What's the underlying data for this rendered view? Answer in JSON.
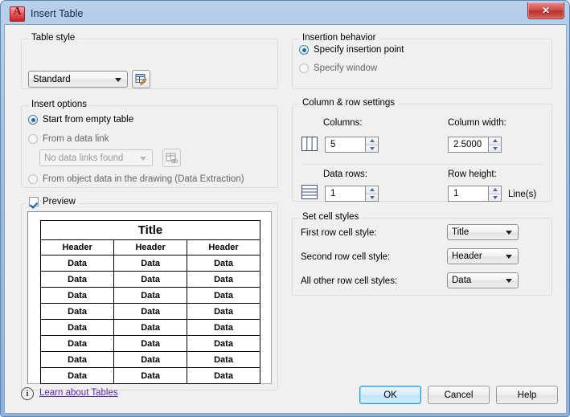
{
  "window": {
    "title": "Insert Table",
    "logo_letter": "A",
    "close_label": "✕"
  },
  "table_style": {
    "group_title": "Table style",
    "selected": "Standard",
    "edit_button_icon": "table-style-edit-icon"
  },
  "insert_options": {
    "group_title": "Insert options",
    "options": [
      {
        "label": "Start from empty table",
        "selected": true,
        "disabled": false
      },
      {
        "label": "From a data link",
        "selected": false,
        "disabled": false
      },
      {
        "label": "From object data in the drawing (Data Extraction)",
        "selected": false,
        "disabled": false
      }
    ],
    "data_link_combo": {
      "value": "No data links found",
      "disabled": true
    },
    "data_link_button_icon": "data-link-icon"
  },
  "insertion_behavior": {
    "group_title": "Insertion behavior",
    "options": [
      {
        "label": "Specify insertion point",
        "selected": true
      },
      {
        "label": "Specify window",
        "selected": false
      }
    ]
  },
  "column_row_settings": {
    "group_title": "Column & row settings",
    "columns_label": "Columns:",
    "columns_value": "5",
    "column_width_label": "Column width:",
    "column_width_value": "2.5000",
    "data_rows_label": "Data rows:",
    "data_rows_value": "1",
    "row_height_label": "Row height:",
    "row_height_value": "1",
    "row_height_units": "Line(s)",
    "columns_icon": "columns-icon",
    "rows_icon": "rows-icon"
  },
  "cell_styles": {
    "group_title": "Set cell styles",
    "rows": [
      {
        "label": "First row cell style:",
        "value": "Title"
      },
      {
        "label": "Second row cell style:",
        "value": "Header"
      },
      {
        "label": "All other row cell styles:",
        "value": "Data"
      }
    ]
  },
  "preview": {
    "checkbox_label": "Preview",
    "checked": true,
    "table": {
      "title": "Title",
      "headers": [
        "Header",
        "Header",
        "Header"
      ],
      "data_rows": [
        [
          "Data",
          "Data",
          "Data"
        ],
        [
          "Data",
          "Data",
          "Data"
        ],
        [
          "Data",
          "Data",
          "Data"
        ],
        [
          "Data",
          "Data",
          "Data"
        ],
        [
          "Data",
          "Data",
          "Data"
        ],
        [
          "Data",
          "Data",
          "Data"
        ],
        [
          "Data",
          "Data",
          "Data"
        ],
        [
          "Data",
          "Data",
          "Data"
        ]
      ]
    }
  },
  "footer": {
    "help_link": "Learn about Tables",
    "info_icon": "info-icon",
    "buttons": [
      {
        "label": "OK",
        "default": true
      },
      {
        "label": "Cancel",
        "default": false
      },
      {
        "label": "Help",
        "default": false
      }
    ]
  },
  "colors": {
    "accent": "#1c6ea4",
    "dialog_bg": "#f0f0f0",
    "link": "#5a2ea6",
    "close_red": "#c2342f"
  }
}
